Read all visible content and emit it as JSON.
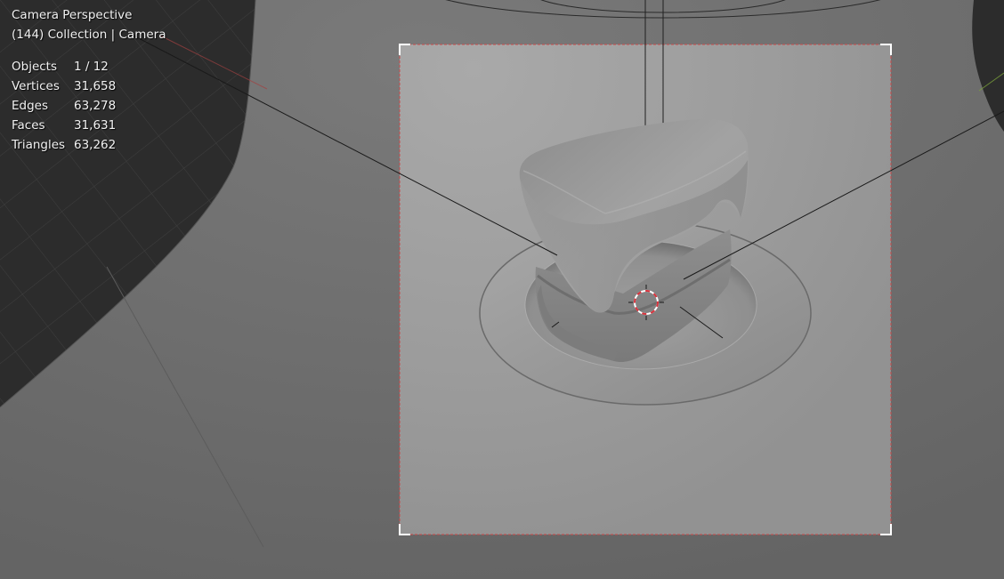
{
  "viewport": {
    "view_name": "Camera Perspective",
    "context": "(144) Collection | Camera"
  },
  "stats": [
    {
      "label": "Objects",
      "value": "1 / 12"
    },
    {
      "label": "Vertices",
      "value": "31,658"
    },
    {
      "label": "Edges",
      "value": "63,278"
    },
    {
      "label": "Faces",
      "value": "31,631"
    },
    {
      "label": "Triangles",
      "value": "63,262"
    }
  ],
  "colors": {
    "viewport_background": "#6b6b6b",
    "camera_frame_fill": "#9a9a9a",
    "dark_object": "#2e2e2e",
    "grid_line": "#3d3d3d",
    "camera_border": "#d94b4b",
    "cursor_red": "#d8323c",
    "x_axis": "#b03a3a",
    "y_axis": "#7aa03a",
    "overlay_text": "#f2f2f2"
  }
}
